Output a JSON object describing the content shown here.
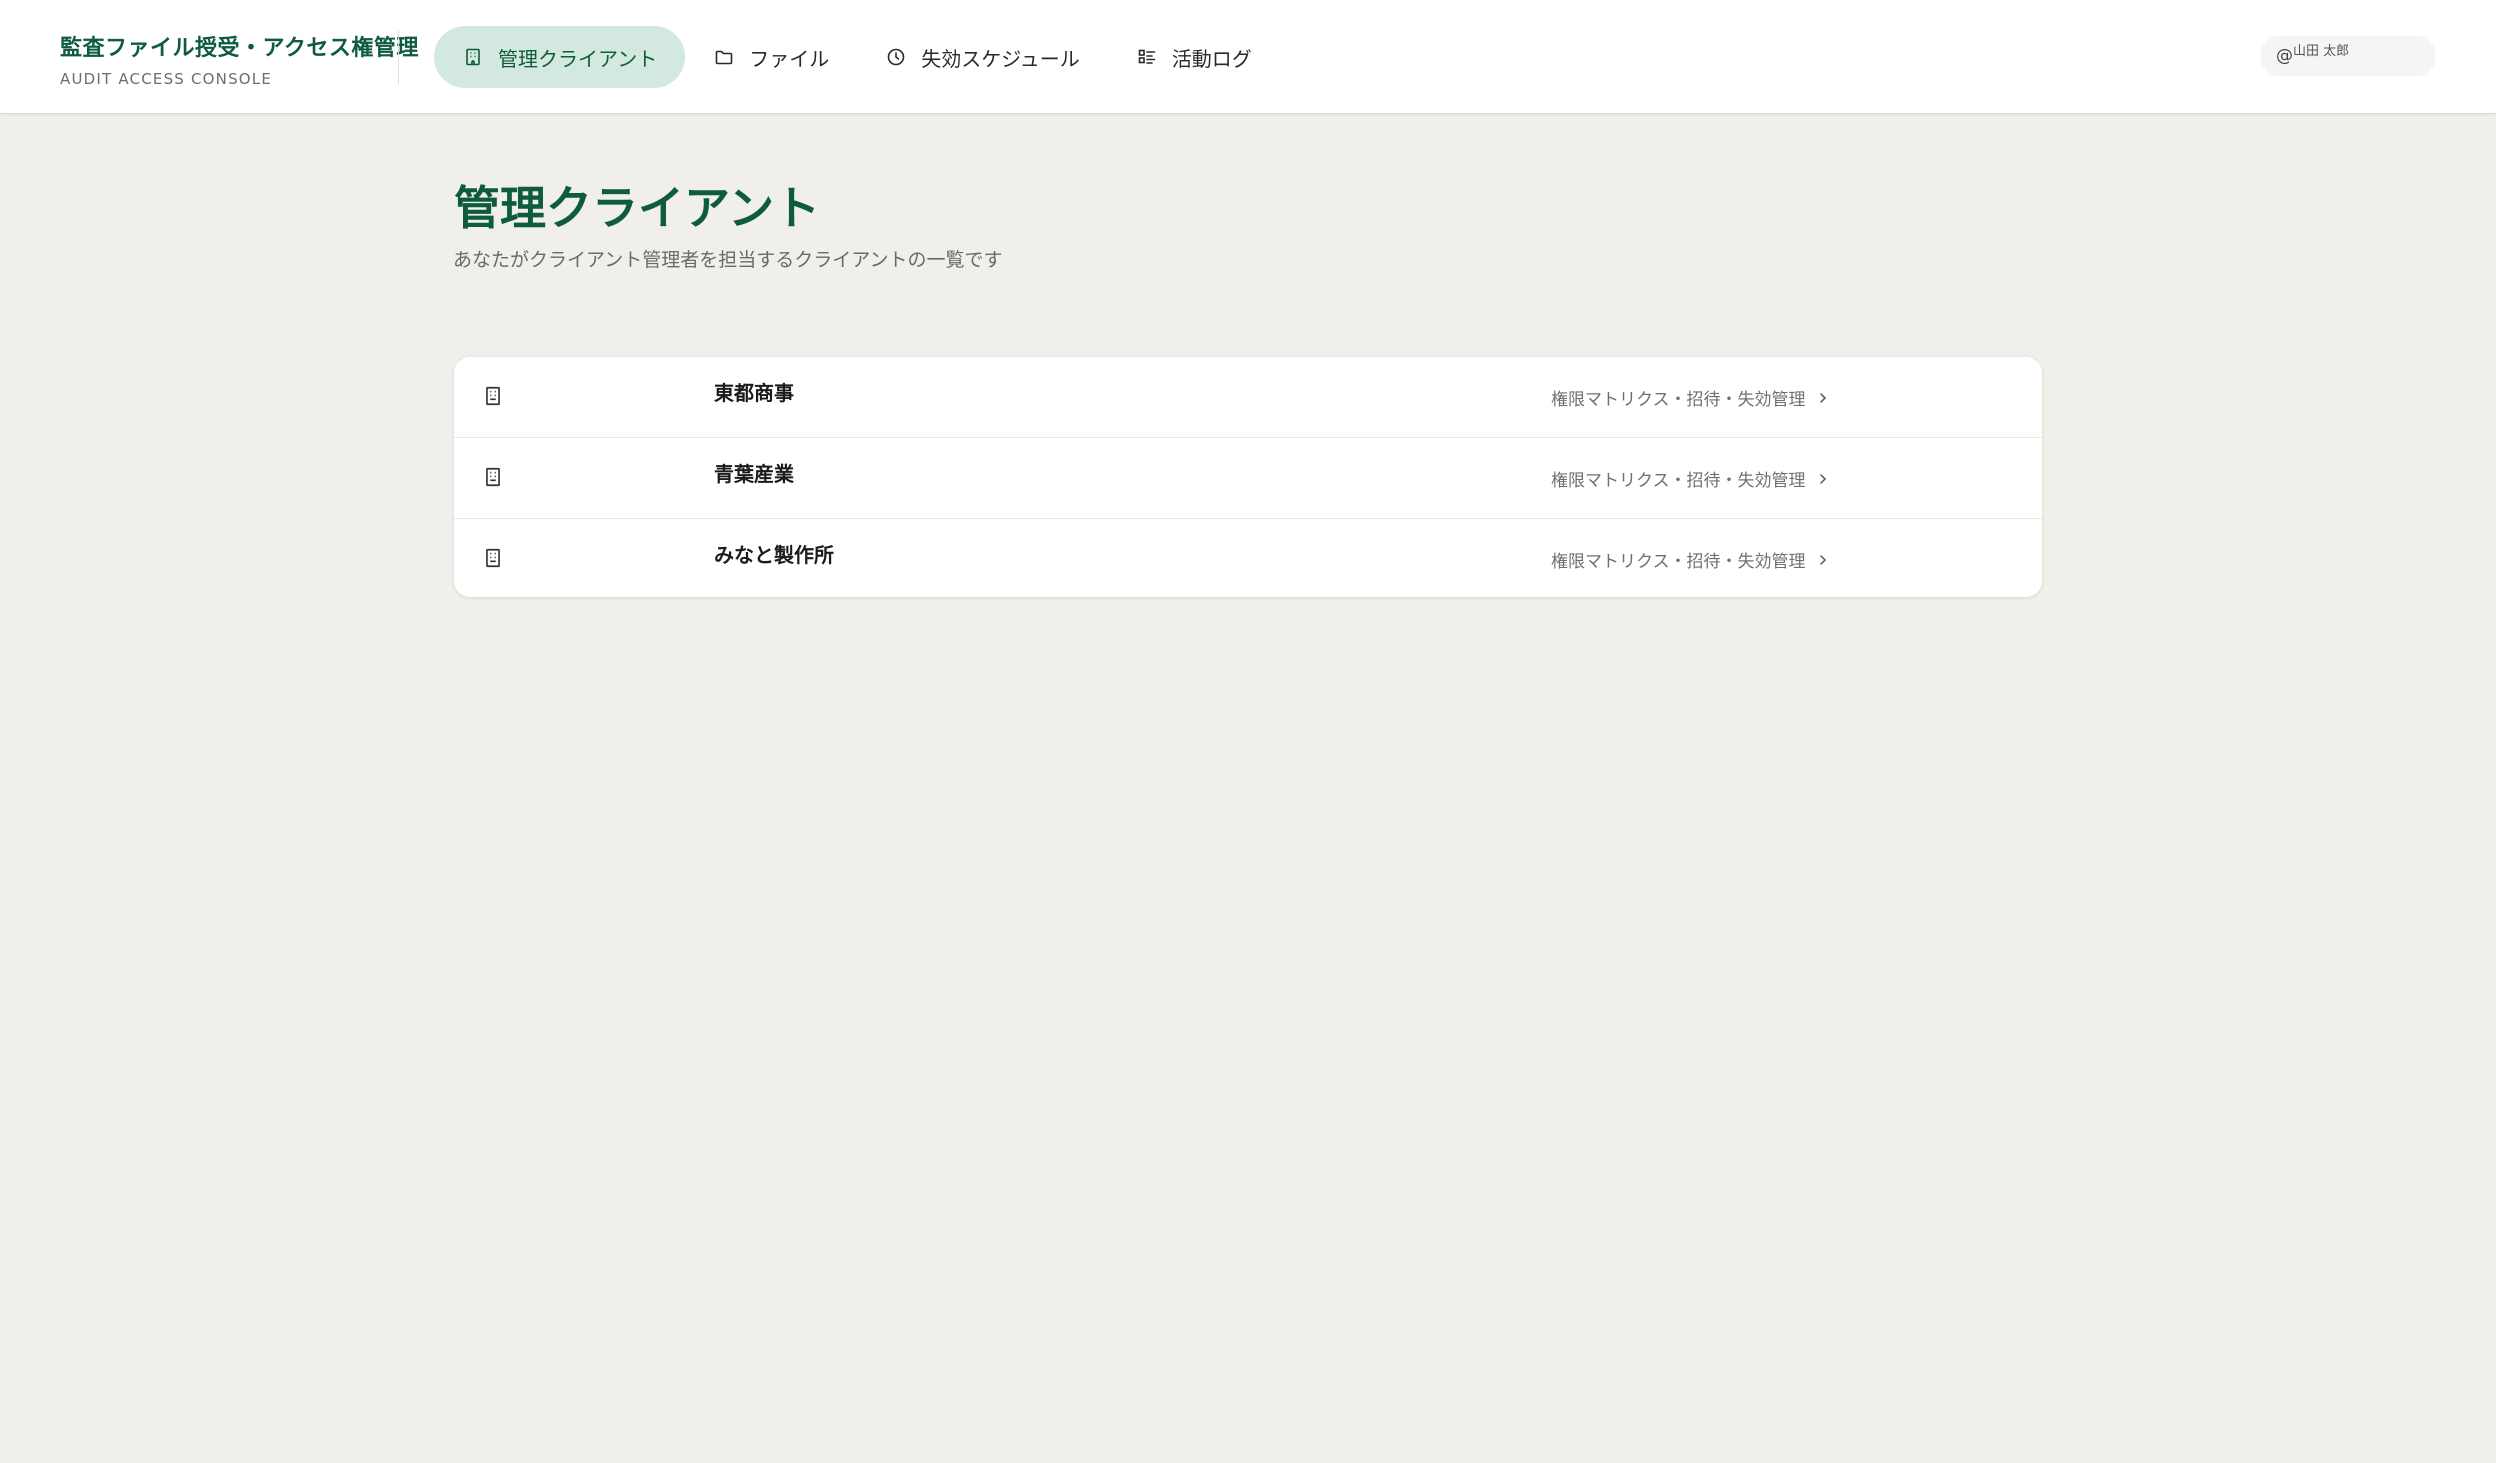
{
  "brand": {
    "title": "監査ファイル授受・アクセス権管理",
    "subtitle": "AUDIT ACCESS CONSOLE"
  },
  "nav": [
    {
      "label": "管理クライアント",
      "icon": "building-icon",
      "active": true
    },
    {
      "label": "ファイル",
      "icon": "folder-icon",
      "active": false
    },
    {
      "label": "失効スケジュール",
      "icon": "clock-icon",
      "active": false
    },
    {
      "label": "活動ログ",
      "icon": "list-checks-icon",
      "active": false
    }
  ],
  "user": {
    "at": "@",
    "name": "山田 太郎"
  },
  "page": {
    "title": "管理クライアント",
    "subtitle": "あなたがクライアント管理者を担当するクライアントの一覧です"
  },
  "clients": [
    {
      "name": "東都商事",
      "action": "権限マトリクス・招待・失効管理"
    },
    {
      "name": "青葉産業",
      "action": "権限マトリクス・招待・失効管理"
    },
    {
      "name": "みなと製作所",
      "action": "権限マトリクス・招待・失効管理"
    }
  ],
  "colors": {
    "accent": "#0f5b3e",
    "active_nav_bg": "#d3e8de",
    "page_bg": "#f0efea"
  }
}
